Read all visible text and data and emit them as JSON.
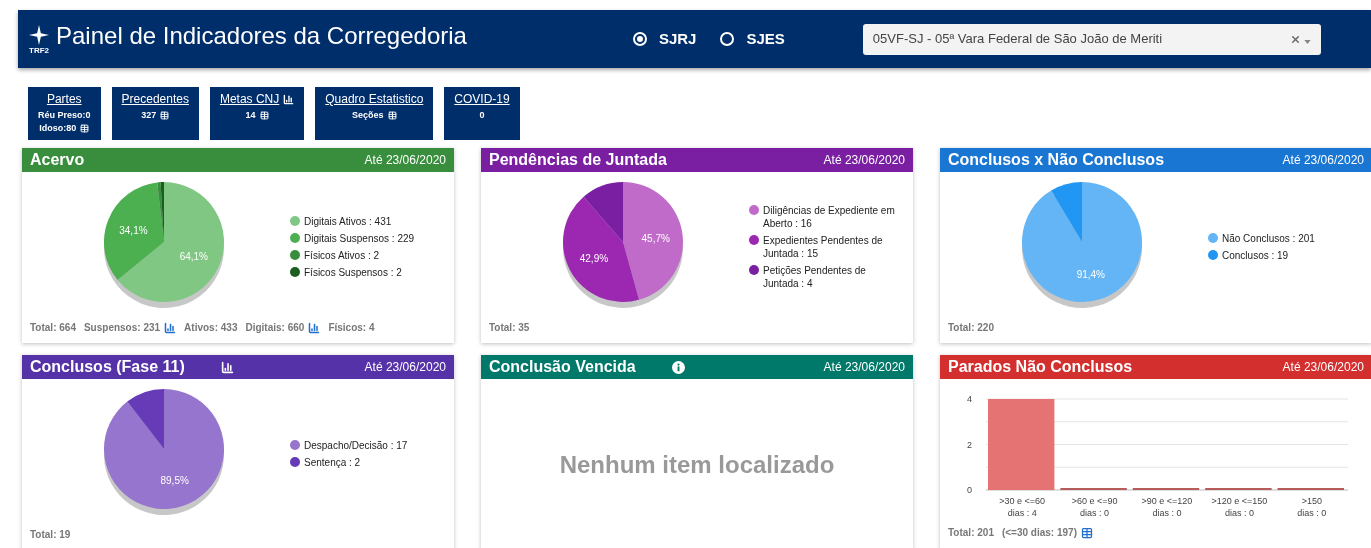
{
  "header": {
    "logo_text": "TRF2",
    "title": "Painel de Indicadores da Corregedoria",
    "regions": [
      {
        "label": "SJRJ",
        "selected": true
      },
      {
        "label": "SJES",
        "selected": false
      }
    ],
    "unit_select": {
      "value": "05VF-SJ - 05ª Vara Federal de São João de Meriti"
    }
  },
  "tiles": [
    {
      "title": "Partes",
      "chart_icon": false,
      "lines": [
        {
          "text": "Réu Preso:0",
          "table_icon": false
        },
        {
          "text": "Idoso:80",
          "table_icon": true
        }
      ]
    },
    {
      "title": "Precedentes",
      "chart_icon": false,
      "lines": [
        {
          "text": "327",
          "table_icon": true
        }
      ]
    },
    {
      "title": "Metas CNJ",
      "chart_icon": true,
      "lines": [
        {
          "text": "14",
          "table_icon": true
        }
      ]
    },
    {
      "title": "Quadro Estatistico",
      "chart_icon": false,
      "lines": [
        {
          "text": "Seções",
          "table_icon": true
        }
      ]
    },
    {
      "title": "COVID-19",
      "chart_icon": false,
      "lines": [
        {
          "text": "0",
          "table_icon": false
        }
      ]
    }
  ],
  "cards": [
    {
      "title": "Acervo",
      "chart_icon": false,
      "info_icon": false,
      "date": "Até 23/06/2020",
      "color": "#388e3c",
      "kind": "pie",
      "legend": [
        {
          "label": "Digitais Ativos : 431",
          "color": "#81c784"
        },
        {
          "label": "Digitais Suspensos : 229",
          "color": "#4caf50"
        },
        {
          "label": "Físicos Ativos : 2",
          "color": "#388e3c"
        },
        {
          "label": "Físicos Suspensos : 2",
          "color": "#1b5e20"
        }
      ],
      "chart_data": {
        "type": "pie",
        "values": [
          64.1,
          34.1,
          0.9,
          0.9
        ],
        "value_labels": [
          "64,1%",
          "34,1%",
          null,
          null
        ]
      },
      "footer": [
        {
          "text": "Total: 664",
          "chart_icon": false,
          "table_icon": false
        },
        {
          "text": "Suspensos: 231",
          "chart_icon": true,
          "table_icon": false
        },
        {
          "text": "Ativos: 433",
          "chart_icon": false,
          "table_icon": false
        },
        {
          "text": "Digitais: 660",
          "chart_icon": true,
          "table_icon": false
        },
        {
          "text": "Físicos: 4",
          "chart_icon": false,
          "table_icon": false
        }
      ]
    },
    {
      "title": "Pendências de Juntada",
      "chart_icon": false,
      "info_icon": false,
      "date": "Até 23/06/2020",
      "color": "#7b1fa2",
      "kind": "pie",
      "legend": [
        {
          "label": "Diligências de Expediente em Aberto : 16",
          "color": "#c06ac9"
        },
        {
          "label": "Expedientes Pendentes de Juntada : 15",
          "color": "#9c27b0"
        },
        {
          "label": "Petições Pendentes de Juntada : 4",
          "color": "#7b1fa2"
        }
      ],
      "chart_data": {
        "type": "pie",
        "values": [
          45.7,
          42.9,
          11.4
        ],
        "value_labels": [
          "45,7%",
          "42,9%",
          null
        ]
      },
      "footer": [
        {
          "text": "Total: 35",
          "chart_icon": false,
          "table_icon": false
        }
      ]
    },
    {
      "title": "Conclusos x Não Conclusos",
      "chart_icon": false,
      "info_icon": false,
      "date": "Até 23/06/2020",
      "color": "#1976d2",
      "kind": "pie",
      "legend": [
        {
          "label": "Não Conclusos : 201",
          "color": "#64b5f6"
        },
        {
          "label": "Conclusos : 19",
          "color": "#2196f3"
        }
      ],
      "chart_data": {
        "type": "pie",
        "values": [
          91.4,
          8.6
        ],
        "value_labels": [
          "91,4%",
          null
        ]
      },
      "footer": [
        {
          "text": "Total: 220",
          "chart_icon": false,
          "table_icon": false
        }
      ]
    },
    {
      "title": "Conclusos (Fase 11)",
      "chart_icon": true,
      "info_icon": false,
      "date": "Até 23/06/2020",
      "color": "#5632a8",
      "kind": "pie",
      "legend": [
        {
          "label": "Despacho/Decisão : 17",
          "color": "#9575cd"
        },
        {
          "label": "Sentença : 2",
          "color": "#673ab7"
        }
      ],
      "chart_data": {
        "type": "pie",
        "values": [
          89.5,
          10.5
        ],
        "value_labels": [
          "89,5%",
          null
        ]
      },
      "footer": [
        {
          "text": "Total: 19",
          "chart_icon": false,
          "table_icon": false
        }
      ]
    },
    {
      "title": "Conclusão Vencida",
      "chart_icon": false,
      "info_icon": true,
      "date": "Até 23/06/2020",
      "color": "#00796b",
      "kind": "empty",
      "message": "Nenhum item localizado"
    },
    {
      "title": "Parados Não Conclusos",
      "chart_icon": false,
      "info_icon": false,
      "date": "Até 23/06/2020",
      "color": "#d32f2f",
      "kind": "bar",
      "chart_data": {
        "type": "bar",
        "categories": [
          ">30 e <=60\ndias : 4",
          ">60 e <=90\ndias : 0",
          ">90 e <=120\ndias : 0",
          ">120 e <=150\ndias : 0",
          ">150\ndias : 0"
        ],
        "series": [
          {
            "color": "#e57373",
            "values": [
              4,
              0,
              0,
              0,
              0
            ]
          }
        ],
        "ylim": [
          0,
          4
        ],
        "yticks": [
          0,
          2,
          4
        ]
      },
      "footer": [
        {
          "text": "Total: 201",
          "chart_icon": false,
          "table_icon": false
        },
        {
          "text": "(<=30 dias: 197)",
          "chart_icon": false,
          "table_icon": true
        }
      ]
    }
  ]
}
